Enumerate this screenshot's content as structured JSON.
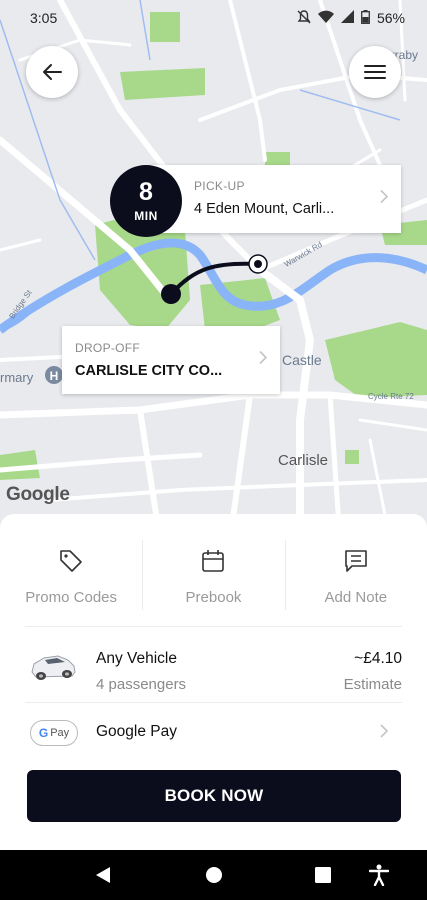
{
  "status_bar": {
    "time": "3:05",
    "battery": "56%"
  },
  "map": {
    "place_labels": {
      "castle": "Castle",
      "carlisle": "Carlisle",
      "rmary": "rmary",
      "arraby": "arraby",
      "bridge_st": "Bridge St",
      "cycle_route": "Cycle Rte 72",
      "warwick_rd": "Warwick Rd"
    },
    "attribution": "Google"
  },
  "pickup": {
    "label": "PICK-UP",
    "address": "4 Eden Mount, Carli..."
  },
  "dropoff": {
    "label": "DROP-OFF",
    "address": "CARLISLE CITY CO..."
  },
  "eta": {
    "value": "8",
    "unit": "MIN"
  },
  "actions": [
    {
      "label": "Promo Codes",
      "icon": "tag-icon"
    },
    {
      "label": "Prebook",
      "icon": "calendar-icon"
    },
    {
      "label": "Add Note",
      "icon": "note-icon"
    }
  ],
  "vehicle": {
    "name": "Any Vehicle",
    "passengers": "4 passengers",
    "price": "~£4.10",
    "price_note": "Estimate"
  },
  "payment": {
    "badge_g": "G",
    "badge_pay": "Pay",
    "method": "Google Pay"
  },
  "book_button": "BOOK NOW",
  "colors": {
    "accent": "#0c0d1c",
    "map_bg": "#e9eaee",
    "park": "#a8d98a",
    "water": "#8ab4f8"
  }
}
